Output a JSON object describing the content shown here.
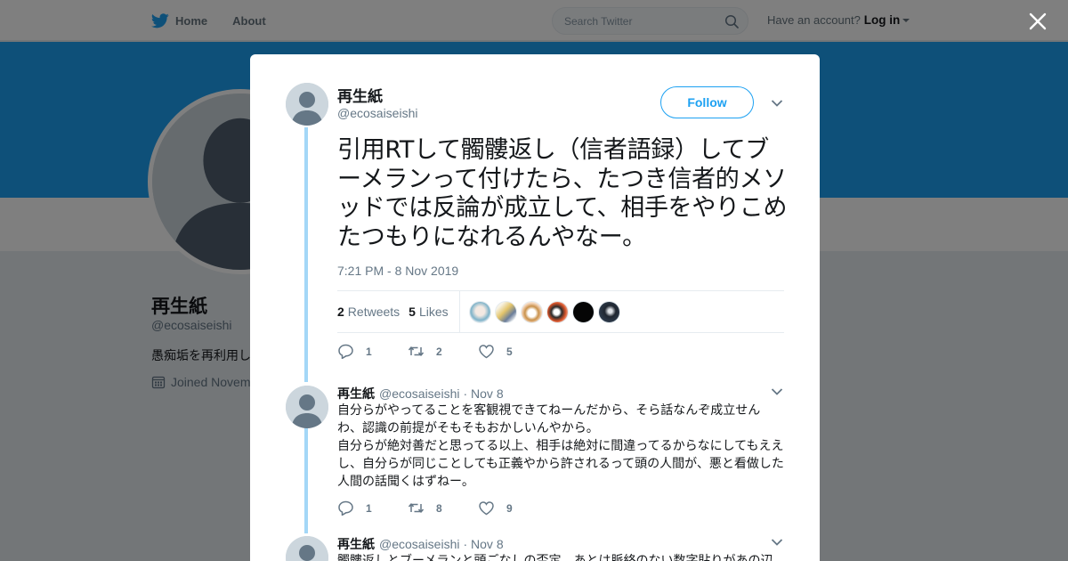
{
  "topnav": {
    "home_label": "Home",
    "about_label": "About",
    "search_placeholder": "Search Twitter",
    "have_account": "Have an account?",
    "login_label": "Log in"
  },
  "profile": {
    "name": "再生紙",
    "handle": "@ecosaiseishi",
    "bio": "愚痴垢を再利用し",
    "joined": "Joined Novem"
  },
  "tweet": {
    "name": "再生紙",
    "handle": "@ecosaiseishi",
    "follow_label": "Follow",
    "text": "引用RTして髑髏返し（信者語録）してブーメランって付けたら、たつき信者的メソッドでは反論が成立して、相手をやりこめたつもりになれるんやなー。",
    "timestamp": "7:21 PM - 8 Nov 2019",
    "retweets_count": "2",
    "retweets_label": "Retweets",
    "likes_count": "5",
    "likes_label": "Likes",
    "actions": {
      "reply": "1",
      "retweet": "2",
      "like": "5"
    }
  },
  "replies": [
    {
      "name": "再生紙",
      "handle": "@ecosaiseishi",
      "date": "· Nov 8",
      "text": "自分らがやってることを客観視できてねーんだから、そら話なんぞ成立せんわ、認識の前提がそもそもおかしいんやから。\n自分らが絶対善だと思ってる以上、相手は絶対に間違ってるからなにしてもええし、自分らが同じことしても正義やから許されるって頭の人間が、悪と看做した人間の話聞くはずねー。",
      "actions": {
        "reply": "1",
        "retweet": "8",
        "like": "9"
      }
    },
    {
      "name": "再生紙",
      "handle": "@ecosaiseishi",
      "date": "· Nov 8",
      "text": "髑髏返しとブーメランと頭ごなしの否定、あとは脈絡のない数字貼りがあの辺"
    }
  ],
  "colors": {
    "accent": "#1da1f2",
    "thread_line": "#a3d7f7",
    "muted_text": "#657786"
  }
}
